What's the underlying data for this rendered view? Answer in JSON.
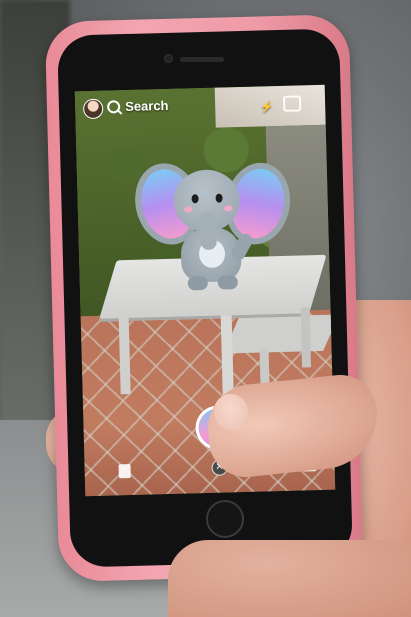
{
  "screen": {
    "search_label": "Search"
  },
  "icons": {
    "avatar": "avatar-icon",
    "search": "search-icon",
    "flash": "flash-icon",
    "flip_camera": "flip-camera-icon",
    "capture": "capture-button",
    "close": "close-icon",
    "memories": "memories-icon",
    "stories": "stories-icon"
  },
  "colors": {
    "phone_case": "#ef9aa7",
    "ear_gradient_top": "#7ec9f4",
    "ear_gradient_mid": "#b58ff0",
    "ear_gradient_bottom": "#f39bd0"
  }
}
